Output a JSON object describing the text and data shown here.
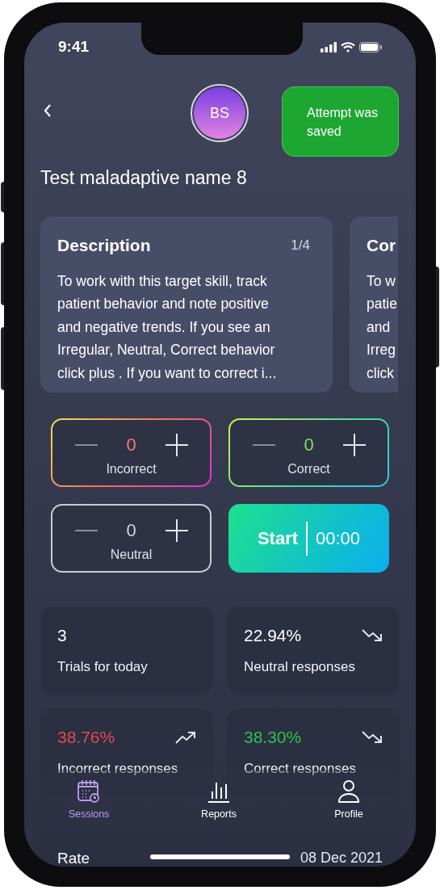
{
  "status_bar": {
    "time": "9:41"
  },
  "header": {
    "avatar": "BS",
    "toast": "Attempt was saved"
  },
  "title": "Test maladaptive name 8",
  "cards": [
    {
      "title": "Description",
      "page": "1/4",
      "lines": [
        "To work with this target skill, track",
        "patient behavior and note positive",
        "and negative trends. If you see an",
        "Irregular, Neutral, Correct behavior",
        "click plus . If you want to correct i..."
      ]
    },
    {
      "title": "Cor",
      "lines": [
        "To w",
        "patie",
        "and",
        "Irreg",
        "click"
      ]
    }
  ],
  "counters": [
    {
      "kind": "incorrect",
      "value": "0",
      "label": "Incorrect"
    },
    {
      "kind": "correct",
      "value": "0",
      "label": "Correct"
    },
    {
      "kind": "neutral",
      "value": "0",
      "label": "Neutral"
    }
  ],
  "start": {
    "label": "Start",
    "timer": "00:00"
  },
  "stats": [
    {
      "value": "3",
      "label": "Trials for today",
      "color": "#ffffff"
    },
    {
      "value": "22.94%",
      "label": "Neutral responses",
      "kind": "down",
      "color": "#ffffff"
    },
    {
      "value": "38.76%",
      "label": "Incorrect responses",
      "kind": "up",
      "color": "#e5484d"
    },
    {
      "value": "38.30%",
      "label": "Correct responses",
      "kind": "down",
      "color": "#2ec24a"
    }
  ],
  "nav": [
    {
      "label": "Sessions",
      "selected": true
    },
    {
      "label": "Reports",
      "selected": false
    },
    {
      "label": "Profile",
      "selected": false
    }
  ],
  "rate": {
    "label": "Rate",
    "date": "08 Dec 2021"
  }
}
